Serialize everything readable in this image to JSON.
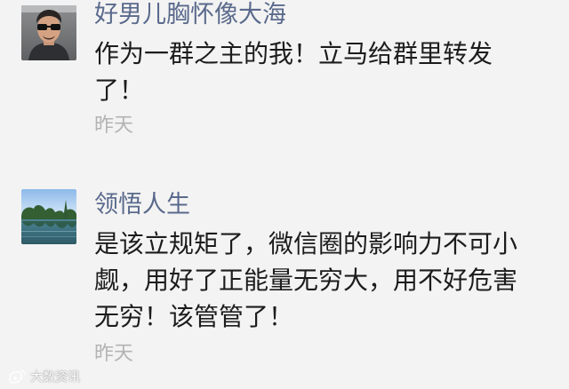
{
  "comments": [
    {
      "username": "好男儿胸怀像大海",
      "content": "作为一群之主的我！立马给群里转发\n了！",
      "time": "昨天",
      "avatar_icon": "man-with-sunglasses-avatar-icon"
    },
    {
      "username": "领悟人生",
      "content": "是该立规矩了，微信圈的影响力不可小\n觑，用好了正能量无穷大，用不好危害\n无穷！该管管了！",
      "time": "昨天",
      "avatar_icon": "lake-landscape-avatar-icon"
    }
  ],
  "watermark": {
    "text": "大数资讯",
    "icon": "weibo-logo-icon"
  }
}
